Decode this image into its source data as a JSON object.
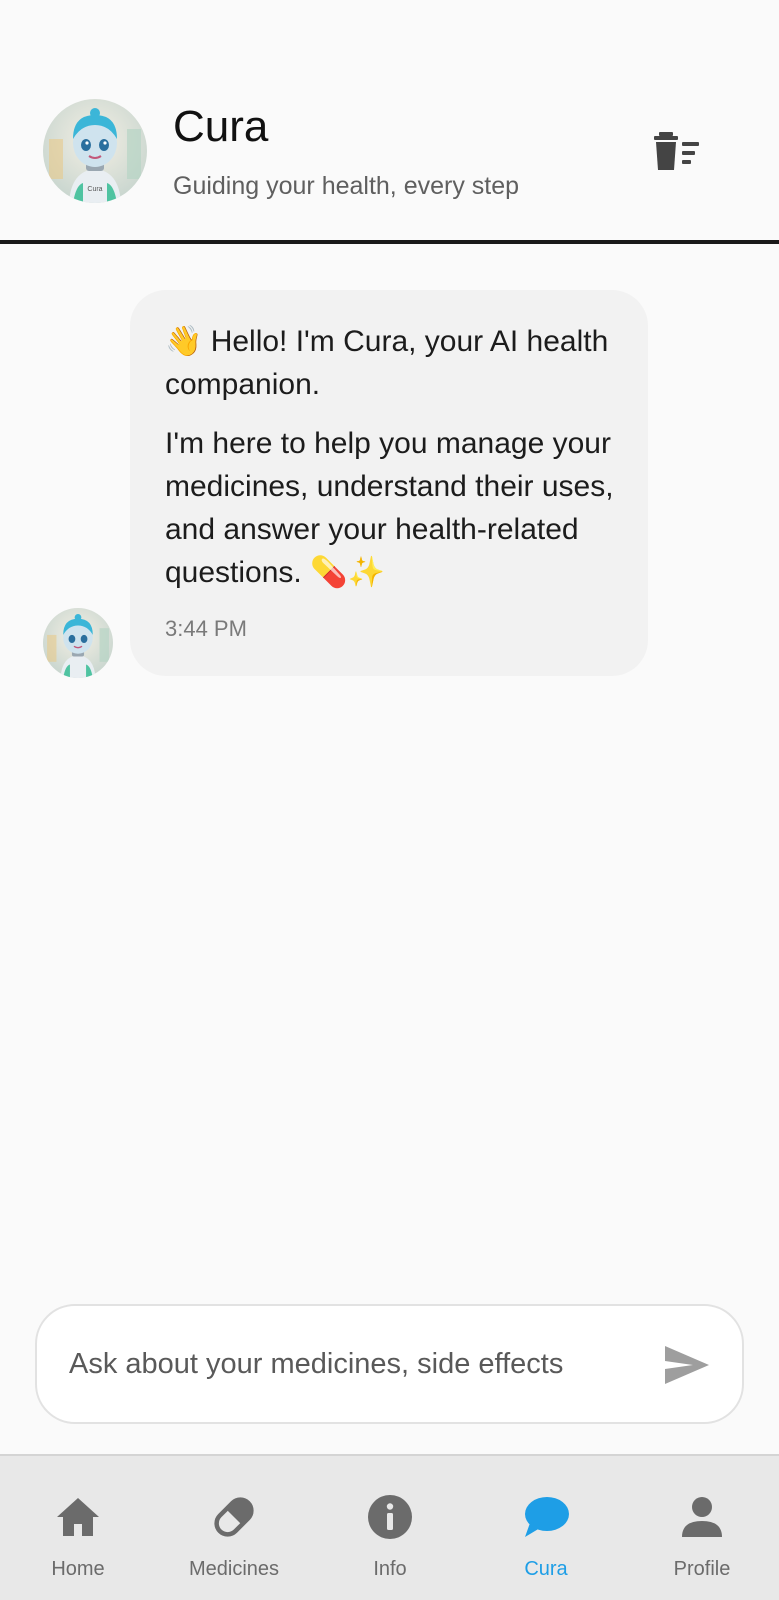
{
  "header": {
    "title": "Cura",
    "subtitle": "Guiding your health, every step",
    "clear_icon": "delete-sweep-icon",
    "avatar_label": "Cura"
  },
  "chat": {
    "messages": [
      {
        "sender": "Cura",
        "paragraphs": [
          "👋 Hello! I'm Cura, your AI health companion.",
          "I'm here to help you manage your medicines, understand their uses, and answer your health-related questions. 💊✨"
        ],
        "time": "3:44 PM"
      }
    ]
  },
  "input": {
    "placeholder": "Ask about your medicines, side effects",
    "value": "",
    "send_icon": "send-icon"
  },
  "nav": {
    "items": [
      {
        "label": "Home",
        "icon": "home-icon"
      },
      {
        "label": "Medicines",
        "icon": "pill-icon"
      },
      {
        "label": "Info",
        "icon": "info-icon"
      },
      {
        "label": "Cura",
        "icon": "chat-icon",
        "active": true
      },
      {
        "label": "Profile",
        "icon": "person-icon"
      }
    ]
  },
  "colors": {
    "accent": "#1e9ee6",
    "icon_gray": "#6b6b6b",
    "bubble": "#f2f2f2",
    "header_divider": "#1a1a1a"
  }
}
